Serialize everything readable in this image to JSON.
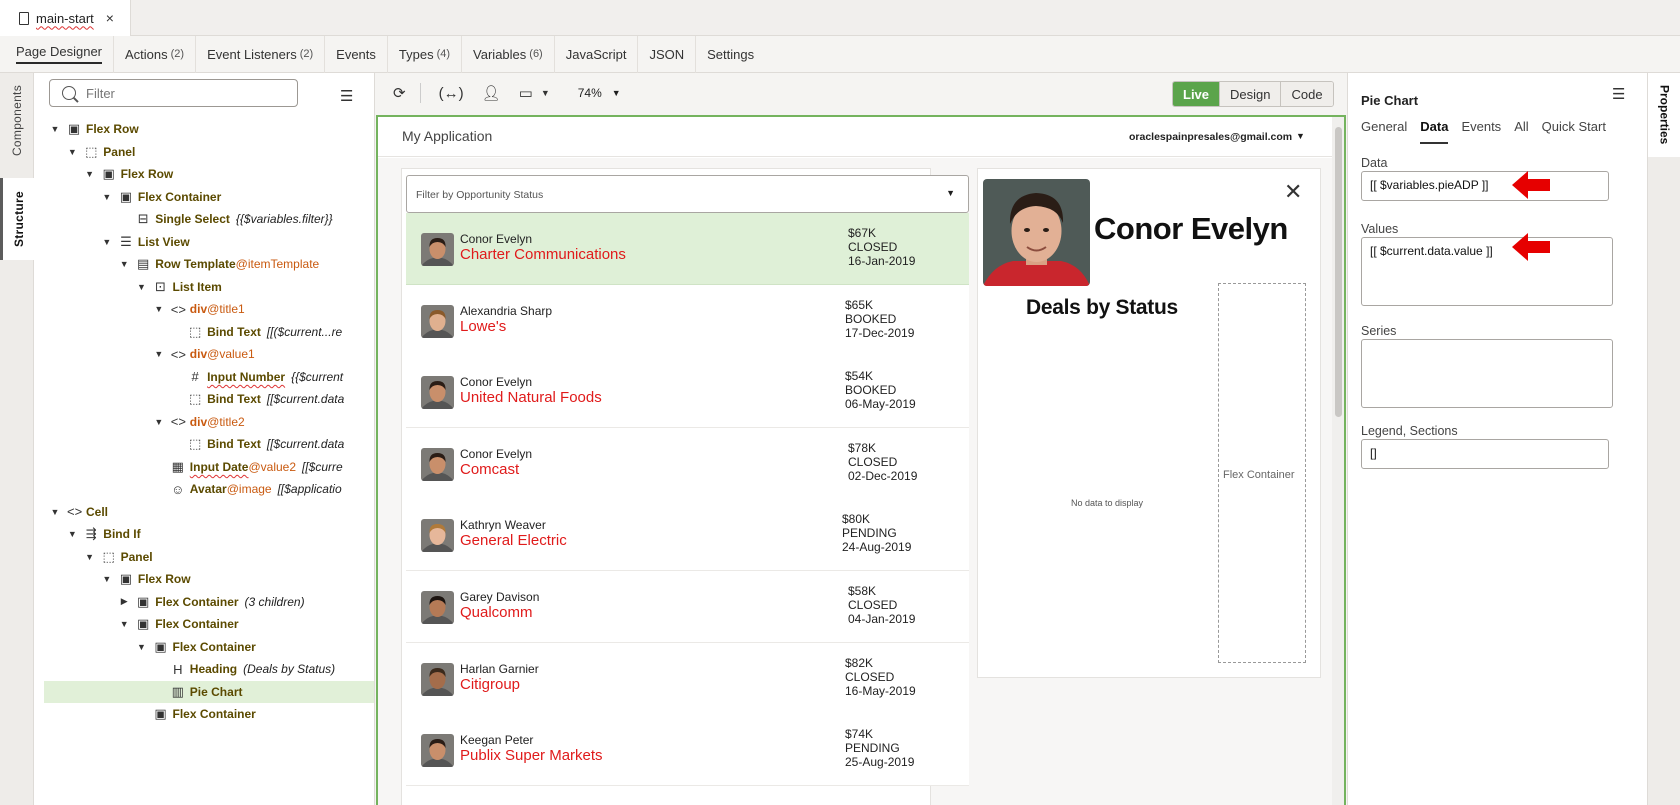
{
  "file_tab": {
    "name": "main-start",
    "close": "×"
  },
  "nav_tabs": [
    {
      "label": "Page Designer",
      "count": ""
    },
    {
      "label": "Actions",
      "count": "(2)"
    },
    {
      "label": "Event Listeners",
      "count": "(2)"
    },
    {
      "label": "Events",
      "count": ""
    },
    {
      "label": "Types",
      "count": "(4)"
    },
    {
      "label": "Variables",
      "count": "(6)"
    },
    {
      "label": "JavaScript",
      "count": ""
    },
    {
      "label": "JSON",
      "count": ""
    },
    {
      "label": "Settings",
      "count": ""
    }
  ],
  "left_tabs": {
    "components": "Components",
    "structure": "Structure"
  },
  "structure": {
    "filter_placeholder": "Filter",
    "tree": [
      {
        "caret": "▼",
        "icon": "▣",
        "name": "Flex Row",
        "id": "",
        "sub": ""
      },
      {
        "caret": "▼",
        "icon": "⬚",
        "name": "Panel",
        "id": "",
        "sub": ""
      },
      {
        "caret": "▼",
        "icon": "▣",
        "name": "Flex Row",
        "id": "",
        "sub": ""
      },
      {
        "caret": "▼",
        "icon": "▣",
        "name": "Flex Container",
        "id": "",
        "sub": ""
      },
      {
        "caret": "",
        "icon": "⊟",
        "name": "Single Select",
        "id": "",
        "sub": "{{$variables.filter}}"
      },
      {
        "caret": "▼",
        "icon": "☰",
        "name": "List View",
        "id": "",
        "sub": ""
      },
      {
        "caret": "▼",
        "icon": "▤",
        "name": "Row Template",
        "id": "@itemTemplate",
        "sub": ""
      },
      {
        "caret": "▼",
        "icon": "⊡",
        "name": "List Item",
        "id": "",
        "sub": ""
      },
      {
        "caret": "▼",
        "icon": "<>",
        "name": "div",
        "id": "@title1",
        "sub": ""
      },
      {
        "caret": "",
        "icon": "⬚",
        "name": "Bind Text",
        "id": "",
        "sub": "[[($current...re"
      },
      {
        "caret": "▼",
        "icon": "<>",
        "name": "div",
        "id": "@value1",
        "sub": ""
      },
      {
        "caret": "",
        "icon": "#",
        "name": "Input Number",
        "id": "",
        "sub": "{{$current"
      },
      {
        "caret": "",
        "icon": "⬚",
        "name": "Bind Text",
        "id": "",
        "sub": "[[$current.data"
      },
      {
        "caret": "▼",
        "icon": "<>",
        "name": "div",
        "id": "@title2",
        "sub": ""
      },
      {
        "caret": "",
        "icon": "⬚",
        "name": "Bind Text",
        "id": "",
        "sub": "[[$current.data"
      },
      {
        "caret": "",
        "icon": "▦",
        "name": "Input Date",
        "id": "@value2",
        "sub": "[[$curre"
      },
      {
        "caret": "",
        "icon": "☺",
        "name": "Avatar",
        "id": "@image",
        "sub": "[[$applicatio"
      },
      {
        "caret": "▼",
        "icon": "<>",
        "name": "Cell",
        "id": "",
        "sub": ""
      },
      {
        "caret": "▼",
        "icon": "⇶",
        "name": "Bind If",
        "id": "",
        "sub": ""
      },
      {
        "caret": "▼",
        "icon": "⬚",
        "name": "Panel",
        "id": "",
        "sub": ""
      },
      {
        "caret": "▼",
        "icon": "▣",
        "name": "Flex Row",
        "id": "",
        "sub": ""
      },
      {
        "caret": "▶",
        "icon": "▣",
        "name": "Flex Container",
        "id": "",
        "sub": "(3 children)"
      },
      {
        "caret": "▼",
        "icon": "▣",
        "name": "Flex Container",
        "id": "",
        "sub": ""
      },
      {
        "caret": "▼",
        "icon": "▣",
        "name": "Flex Container",
        "id": "",
        "sub": ""
      },
      {
        "caret": "",
        "icon": "H",
        "name": "Heading",
        "id": "",
        "sub": "(Deals by Status)"
      },
      {
        "caret": "",
        "icon": "▥",
        "name": "Pie Chart",
        "id": "",
        "sub": ""
      },
      {
        "caret": "",
        "icon": "▣",
        "name": "Flex Container",
        "id": "",
        "sub": ""
      }
    ]
  },
  "canvas": {
    "zoom": "74%",
    "modes": [
      "Live",
      "Design",
      "Code"
    ],
    "app_title": "My Application",
    "user_email": "oraclespainpresales@gmail.com",
    "filter_placeholder": "Filter by Opportunity Status",
    "opportunities": [
      {
        "name": "Conor Evelyn",
        "company": "Charter Communications",
        "amount": "$67K",
        "status": "CLOSED",
        "date": "16-Jan-2019",
        "selected": true
      },
      {
        "name": "Alexandria Sharp",
        "company": "Lowe's",
        "amount": "$65K",
        "status": "BOOKED",
        "date": "17-Dec-2019",
        "selected": false
      },
      {
        "name": "Conor Evelyn",
        "company": "United Natural Foods",
        "amount": "$54K",
        "status": "BOOKED",
        "date": "06-May-2019",
        "selected": false
      },
      {
        "name": "Conor Evelyn",
        "company": "Comcast",
        "amount": "$78K",
        "status": "CLOSED",
        "date": "02-Dec-2019",
        "selected": false
      },
      {
        "name": "Kathryn Weaver",
        "company": "General Electric",
        "amount": "$80K",
        "status": "PENDING",
        "date": "24-Aug-2019",
        "selected": false
      },
      {
        "name": "Garey Davison",
        "company": "Qualcomm",
        "amount": "$58K",
        "status": "CLOSED",
        "date": "04-Jan-2019",
        "selected": false
      },
      {
        "name": "Harlan Garnier",
        "company": "Citigroup",
        "amount": "$82K",
        "status": "CLOSED",
        "date": "16-May-2019",
        "selected": false
      },
      {
        "name": "Keegan Peter",
        "company": "Publix Super Markets",
        "amount": "$74K",
        "status": "PENDING",
        "date": "25-Aug-2019",
        "selected": false
      }
    ],
    "detail": {
      "name": "Conor Evelyn",
      "heading": "Deals by Status",
      "no_data": "No data to display",
      "flex_placeholder": "Flex Container"
    }
  },
  "properties": {
    "tab_label": "Properties",
    "title": "Pie Chart",
    "tabs": [
      "General",
      "Data",
      "Events",
      "All",
      "Quick Start"
    ],
    "active_tab": "Data",
    "fields": {
      "data_label": "Data",
      "data_value": "[[ $variables.pieADP ]]",
      "values_label": "Values",
      "values_value": "[[ $current.data.value ]]",
      "series_label": "Series",
      "series_value": "",
      "legend_label": "Legend, Sections",
      "legend_value": "[]"
    },
    "annotation_color": "#e60000"
  }
}
